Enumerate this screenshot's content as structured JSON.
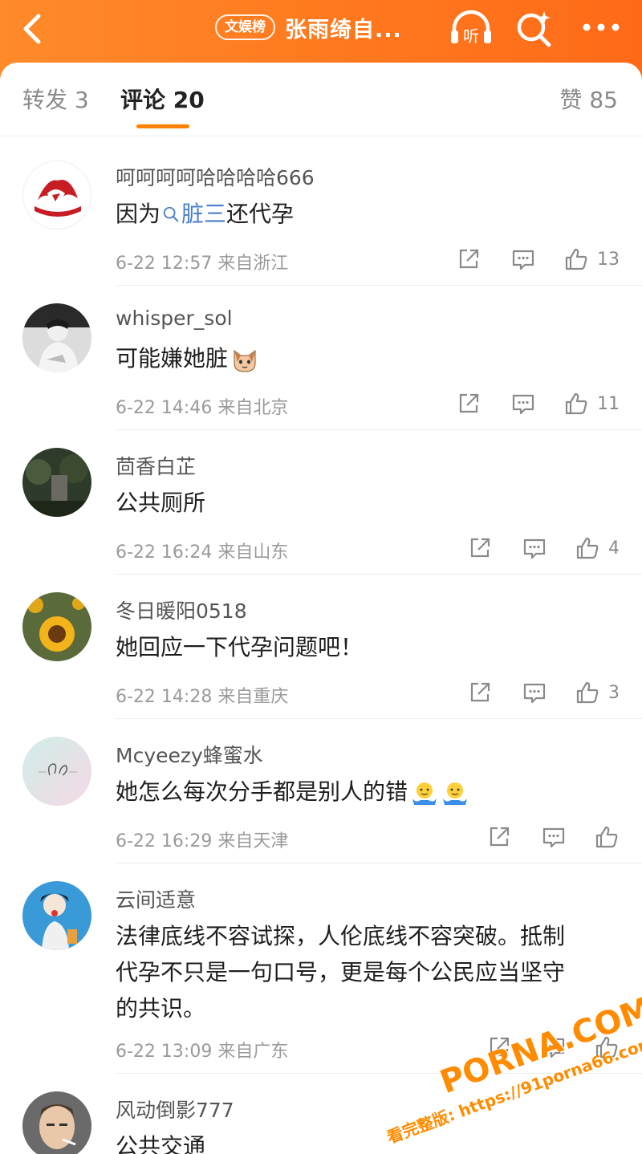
{
  "header": {
    "back_icon": "chevron-left-icon",
    "tag": "文娱榜",
    "title": "张雨绮自...",
    "listen_label": "听",
    "search_icon": "search-sparkle-icon",
    "more_icon": "more-horizontal-icon",
    "gradient": [
      "#ff8a2a",
      "#ff6a18"
    ]
  },
  "tabs": {
    "repost": "转发 3",
    "comments": "评论 20",
    "likes": "赞 85",
    "accent": "#ff8200"
  },
  "comments": [
    {
      "username": "呵呵呵呵哈哈哈哈666",
      "content_prefix": "因为",
      "search_term": "脏三",
      "content_suffix": "还代孕",
      "time": "6-22 12:57",
      "location": "来自浙江",
      "likes": "13"
    },
    {
      "username": "whisper_sol",
      "content": "可能嫌她脏",
      "emoji": "cat-face-emoji",
      "time": "6-22 14:46",
      "location": "来自北京",
      "likes": "11"
    },
    {
      "username": "茴香白芷",
      "content": "公共厕所",
      "time": "6-22 16:24",
      "location": "来自山东",
      "likes": "4"
    },
    {
      "username": "冬日暖阳0518",
      "content": "她回应一下代孕问题吧！",
      "time": "6-22 14:28",
      "location": "来自重庆",
      "likes": "3"
    },
    {
      "username": "Mcyeezy蜂蜜水",
      "content": "她怎么每次分手都是别人的错",
      "emoji": "shrug-emoji",
      "time": "6-22 16:29",
      "location": "来自天津",
      "likes": ""
    },
    {
      "username": "云间适意",
      "content_line1": "法律底线不容试探，人伦底线不容突破。抵制",
      "content_line2": "代孕不只是一句口号，更是每个公民应当坚守",
      "content_line3": "的共识。",
      "time": "6-22 13:09",
      "location": "来自广东",
      "likes": ""
    },
    {
      "username": "风动倒影777",
      "content": "公共交通"
    }
  ],
  "watermark": {
    "brand": "PORNA.COM",
    "url_line": "看完整版: https://91porna66.com"
  }
}
